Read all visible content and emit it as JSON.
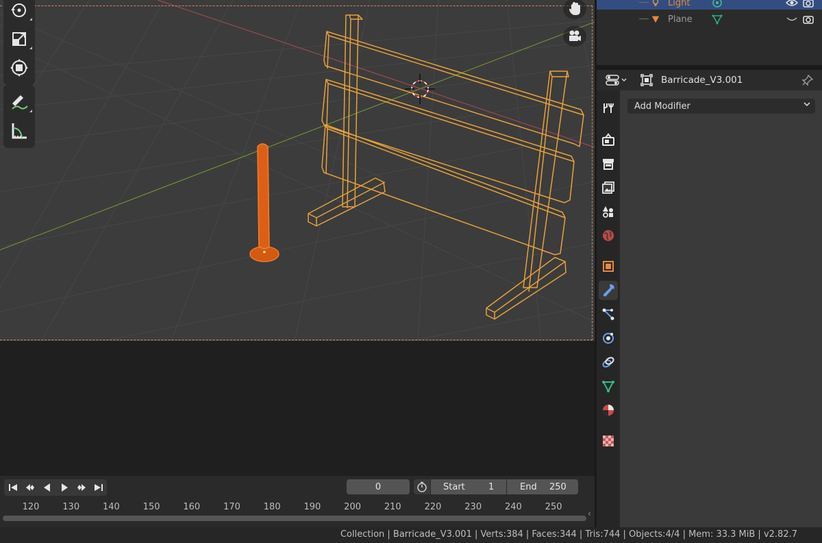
{
  "viewport": {
    "icons": [
      "rotate-icon",
      "scale-icon",
      "transform-icon",
      "annotate-icon",
      "measure-icon",
      "hand-icon",
      "camera-icon"
    ]
  },
  "outliner": {
    "rows": [
      {
        "name": "Light",
        "name_color": "#e38a3a",
        "selected": true
      },
      {
        "name": "Plane",
        "name_color": "#9a9a9a",
        "selected": false
      }
    ]
  },
  "properties": {
    "object_name": "Barricade_V3.001",
    "add_modifier_label": "Add Modifier"
  },
  "timeline": {
    "current_frame": "0",
    "start_label": "Start",
    "start_value": "1",
    "end_label": "End",
    "end_value": "250",
    "ruler": [
      "120",
      "130",
      "140",
      "150",
      "160",
      "170",
      "180",
      "190",
      "200",
      "210",
      "220",
      "230",
      "240",
      "250"
    ]
  },
  "statusbar": {
    "text": "Collection | Barricade_V3.001 | Verts:384 | Faces:344 | Tris:744 | Objects:4/4 | Mem: 33.3 MiB | v2.82.7"
  },
  "colors": {
    "selection_orange": "#f5a033",
    "active_orange": "#e0661c",
    "outliner_selected": "#334d80"
  }
}
